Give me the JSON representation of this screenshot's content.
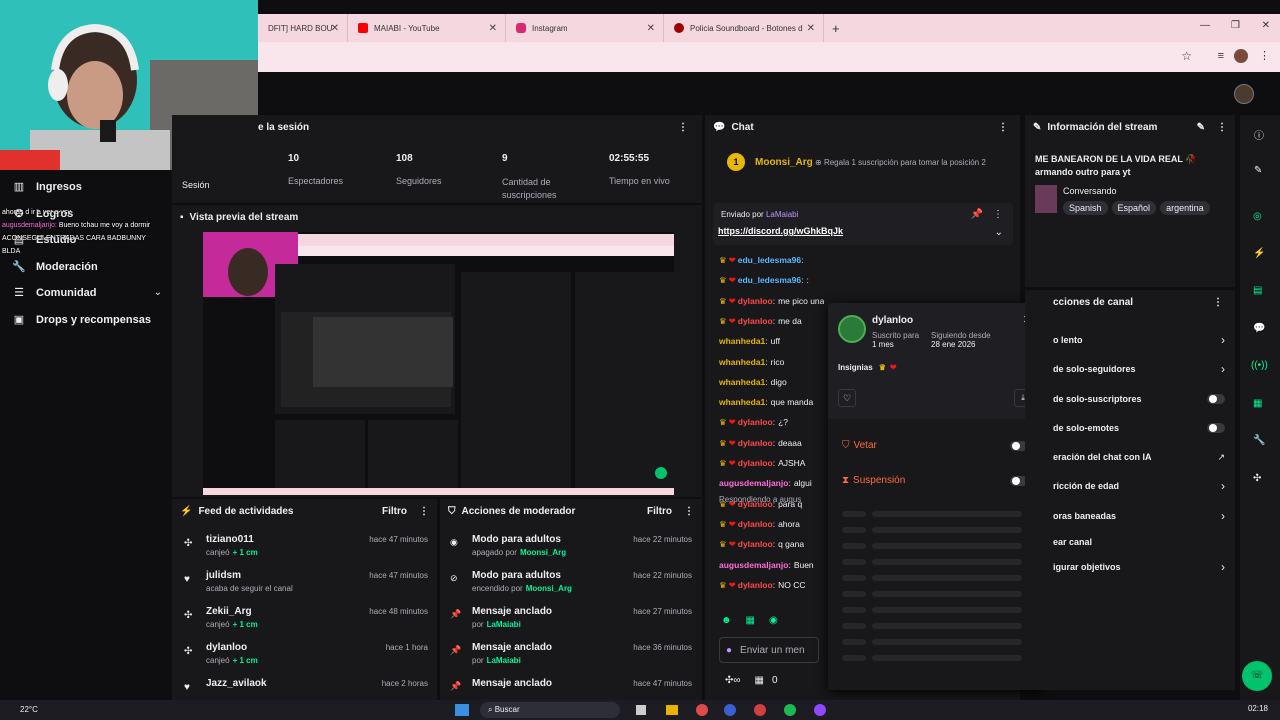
{
  "browser": {
    "tabs": [
      {
        "label": "DFIT] HARD BOU",
        "color": "#e91916"
      },
      {
        "label": "MAIABI - YouTube",
        "color": "#ff0000"
      },
      {
        "label": "Instagram",
        "color": "#d62976"
      },
      {
        "label": "Policia Soundboard - Botones d",
        "color": "#a00000"
      }
    ]
  },
  "left_nav": {
    "items": [
      {
        "label": "Ingresos"
      },
      {
        "label": "Logros"
      },
      {
        "label": "Estudio"
      },
      {
        "label": "Moderación"
      },
      {
        "label": "Comunidad"
      },
      {
        "label": "Drops y recompensas"
      }
    ],
    "overlay_chat": [
      {
        "user": "",
        "text": "ahoras d ir a ver a ysy"
      },
      {
        "user": "augusdemaljanjo:",
        "text": "Bueno tchau me voy a dormir"
      },
      {
        "user": "",
        "text": "ACONSEGUI ENTRADAS CARA BADBUNNY"
      },
      {
        "user": "BLDA",
        "text": ""
      }
    ]
  },
  "session": {
    "title": "e la sesión",
    "sesion_label": "Sesión",
    "stats": [
      {
        "value": "10",
        "label": "Espectadores"
      },
      {
        "value": "108",
        "label": "Seguidores"
      },
      {
        "value": "9",
        "label": "Cantidad de suscripciones"
      },
      {
        "value": "02:55:55",
        "label": "Tiempo en vivo"
      }
    ]
  },
  "preview": {
    "title": "Vista previa del stream"
  },
  "activity": {
    "title": "Feed de actividades",
    "filter": "Filtro",
    "items": [
      {
        "user": "tiziano011",
        "action": "canjeó",
        "extra": "+ 1 cm",
        "time": "hace 47 minutos",
        "icon": "points-icon"
      },
      {
        "user": "julidsm",
        "action": "acaba de seguir el canal",
        "extra": "",
        "time": "hace 47 minutos",
        "icon": "heart-icon"
      },
      {
        "user": "Zekii_Arg",
        "action": "canjeó",
        "extra": "+ 1 cm",
        "time": "hace 48 minutos",
        "icon": "points-icon"
      },
      {
        "user": "dylanloo",
        "action": "canjeó",
        "extra": "+ 1 cm",
        "time": "hace 1 hora",
        "icon": "points-icon"
      },
      {
        "user": "Jazz_avilaok",
        "action": "",
        "extra": "",
        "time": "hace 2 horas",
        "icon": "heart-icon"
      }
    ]
  },
  "mod_actions": {
    "title": "Acciones de moderador",
    "filter": "Filtro",
    "items": [
      {
        "title": "Modo para adultos",
        "sub": "apagado por",
        "by": "Moonsi_Arg",
        "time": "hace 22 minutos",
        "icon": "eye-icon"
      },
      {
        "title": "Modo para adultos",
        "sub": "encendido por",
        "by": "Moonsi_Arg",
        "time": "hace 22 minutos",
        "icon": "eye-off-icon"
      },
      {
        "title": "Mensaje anclado",
        "sub": "por",
        "by": "LaMaiabi",
        "time": "hace 27 minutos",
        "icon": "pin-icon"
      },
      {
        "title": "Mensaje anclado",
        "sub": "por",
        "by": "LaMaiabi",
        "time": "hace 36 minutos",
        "icon": "pin-icon"
      },
      {
        "title": "Mensaje anclado",
        "sub": "",
        "by": "",
        "time": "hace 47 minutos",
        "icon": "pin-icon"
      }
    ]
  },
  "chat": {
    "title": "Chat",
    "gift_user": "Moonsi_Arg",
    "gift_rank": "1",
    "gift_text": "Regala 1 suscripción para tomar la posición 2",
    "pinned_by_label": "Enviado por",
    "pinned_by": "LaMaiabi",
    "pinned_link": "https://discord.gg/wGhkBqJk",
    "messages": [
      {
        "user": "edu_ledesma96",
        "text": "",
        "color": "#5ab8ff"
      },
      {
        "user": "edu_ledesma96",
        "text": ":",
        "color": "#5ab8ff"
      },
      {
        "user": "dylanloo",
        "text": "me pico una avispa arriba de la nalga y me puse crema, estoy acostado",
        "color": "#ff4a4a"
      },
      {
        "user": "dylanloo",
        "text": "me da",
        "color": "#ff4a4a"
      },
      {
        "user": "whanheda1",
        "text": "uff",
        "color": "#e8b400"
      },
      {
        "user": "whanheda1",
        "text": "rico",
        "color": "#e8b400"
      },
      {
        "user": "whanheda1",
        "text": "digo",
        "color": "#e8b400"
      },
      {
        "user": "whanheda1",
        "text": "que manda",
        "color": "#e8b400"
      },
      {
        "user": "dylanloo",
        "text": "¿?",
        "color": "#ff4a4a"
      },
      {
        "user": "dylanloo",
        "text": "deaaa",
        "color": "#ff4a4a"
      },
      {
        "user": "dylanloo",
        "text": "AJSHA",
        "color": "#ff4a4a"
      },
      {
        "user": "augusdemaljanjo",
        "text": "algui",
        "color": "#ff6ed9"
      },
      {
        "user": "dylanloo",
        "text": "para q",
        "color": "#ff4a4a"
      },
      {
        "user": "dylanloo",
        "text": "ahora",
        "color": "#ff4a4a"
      },
      {
        "user": "dylanloo",
        "text": "q gana",
        "color": "#ff4a4a"
      },
      {
        "user": "augusdemaljanjo",
        "text": "Buen",
        "color": "#ff6ed9"
      },
      {
        "user": "dylanloo",
        "text": "NO CC",
        "color": "#ff4a4a"
      }
    ],
    "replying": "Respondiendo a augus",
    "input_placeholder": "Enviar un men",
    "count": "0"
  },
  "user_card": {
    "name": "dylanloo",
    "sub_label": "Suscrito para",
    "sub_value": "1 mes",
    "follow_label": "Siguiendo desde",
    "follow_value": "28 ene 2026",
    "badges_label": "Insignias",
    "ban_label": "Vetar",
    "timeout_label": "Suspensión"
  },
  "stream_info": {
    "title": "Información del stream",
    "stream_title": "ME BANEARON DE LA VIDA REAL 🥀 armando outro para yt",
    "category": "Conversando",
    "tags": [
      "Spanish",
      "Español",
      "argentina"
    ]
  },
  "channel_actions": {
    "title": "cciones de canal",
    "items": [
      {
        "label": "o lento",
        "control": "chevron"
      },
      {
        "label": "de solo-seguidores",
        "control": "chevron"
      },
      {
        "label": "de solo-suscriptores",
        "control": "toggle"
      },
      {
        "label": "de solo-emotes",
        "control": "toggle"
      },
      {
        "label": "eración del chat con IA",
        "control": "external"
      },
      {
        "label": "ricción de edad",
        "control": "chevron"
      },
      {
        "label": "oras baneadas",
        "control": "chevron"
      },
      {
        "label": "ear canal",
        "control": "none"
      },
      {
        "label": "igurar objetivos",
        "control": "chevron"
      }
    ]
  },
  "taskbar": {
    "weather": "22°C",
    "search": "Buscar",
    "time": "02:18"
  }
}
